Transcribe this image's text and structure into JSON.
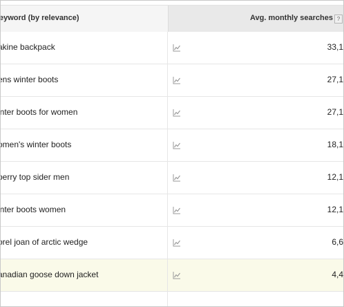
{
  "table": {
    "header": {
      "keyword_col": "eyword (by relevance)",
      "searches_col": "Avg. monthly searches",
      "help_label": "?"
    },
    "rows": [
      {
        "keyword": "akine backpack",
        "searches": "33,1",
        "highlight": false
      },
      {
        "keyword": "ens winter boots",
        "searches": "27,1",
        "highlight": false
      },
      {
        "keyword": "inter boots for women",
        "searches": "27,1",
        "highlight": false
      },
      {
        "keyword": "omen's winter boots",
        "searches": "18,1",
        "highlight": false
      },
      {
        "keyword": "perry top sider men",
        "searches": "12,1",
        "highlight": false
      },
      {
        "keyword": "inter boots women",
        "searches": "12,1",
        "highlight": false
      },
      {
        "keyword": "orel joan of arctic wedge",
        "searches": "6,6",
        "highlight": false
      },
      {
        "keyword": "anadian goose down jacket",
        "searches": "4,4",
        "highlight": true
      }
    ],
    "trend_icon": "line-chart-icon"
  }
}
